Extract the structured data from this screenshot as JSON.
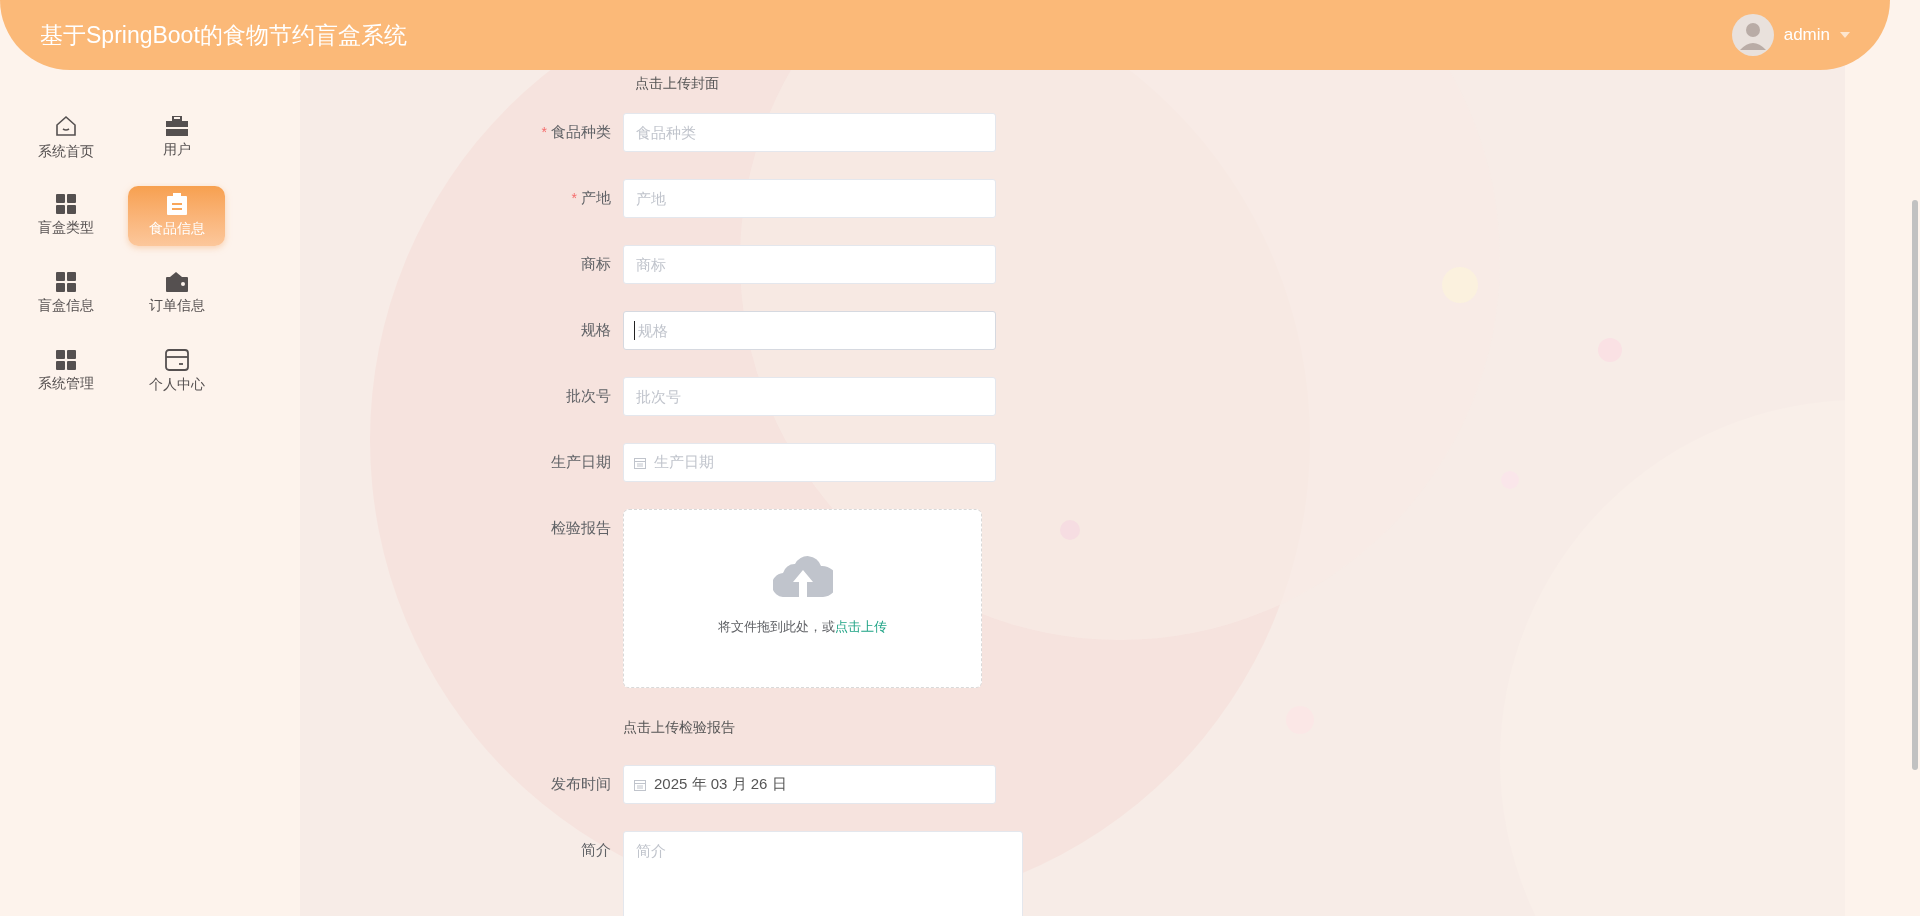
{
  "header": {
    "title": "基于SpringBoot的食物节约盲盒系统",
    "user": "admin"
  },
  "sidebar": {
    "items": [
      {
        "label": "系统首页",
        "kind": "home",
        "selected": false
      },
      {
        "label": "用户",
        "kind": "briefcase",
        "selected": false
      },
      {
        "label": "盲盒类型",
        "kind": "grid",
        "selected": false
      },
      {
        "label": "食品信息",
        "kind": "clipboard",
        "selected": true
      },
      {
        "label": "盲盒信息",
        "kind": "grid",
        "selected": false
      },
      {
        "label": "订单信息",
        "kind": "wallet",
        "selected": false
      },
      {
        "label": "系统管理",
        "kind": "grid",
        "selected": false
      },
      {
        "label": "个人中心",
        "kind": "card",
        "selected": false
      }
    ]
  },
  "form": {
    "cover_hint": "点击上传封面",
    "fields": [
      {
        "kind": "text",
        "label": "食品种类",
        "required_mark": "*",
        "placeholder": "食品种类",
        "focused": false
      },
      {
        "kind": "text",
        "label": "产地",
        "required_mark": "*",
        "placeholder": "产地",
        "focused": false
      },
      {
        "kind": "text",
        "label": "商标",
        "placeholder": "商标",
        "focused": false
      },
      {
        "kind": "text",
        "label": "规格",
        "placeholder": "规格",
        "focused": true
      },
      {
        "kind": "text",
        "label": "批次号",
        "placeholder": "批次号",
        "focused": false
      },
      {
        "kind": "date",
        "label": "生产日期",
        "placeholder": "生产日期"
      },
      {
        "kind": "upload",
        "label": "检验报告",
        "prompt": "将文件拖到此处，或",
        "link": "点击上传",
        "hint": "点击上传检验报告"
      },
      {
        "kind": "date",
        "label": "发布时间",
        "value": "2025 年 03 月 26 日"
      },
      {
        "kind": "textarea",
        "label": "简介",
        "placeholder": "简介"
      }
    ]
  }
}
